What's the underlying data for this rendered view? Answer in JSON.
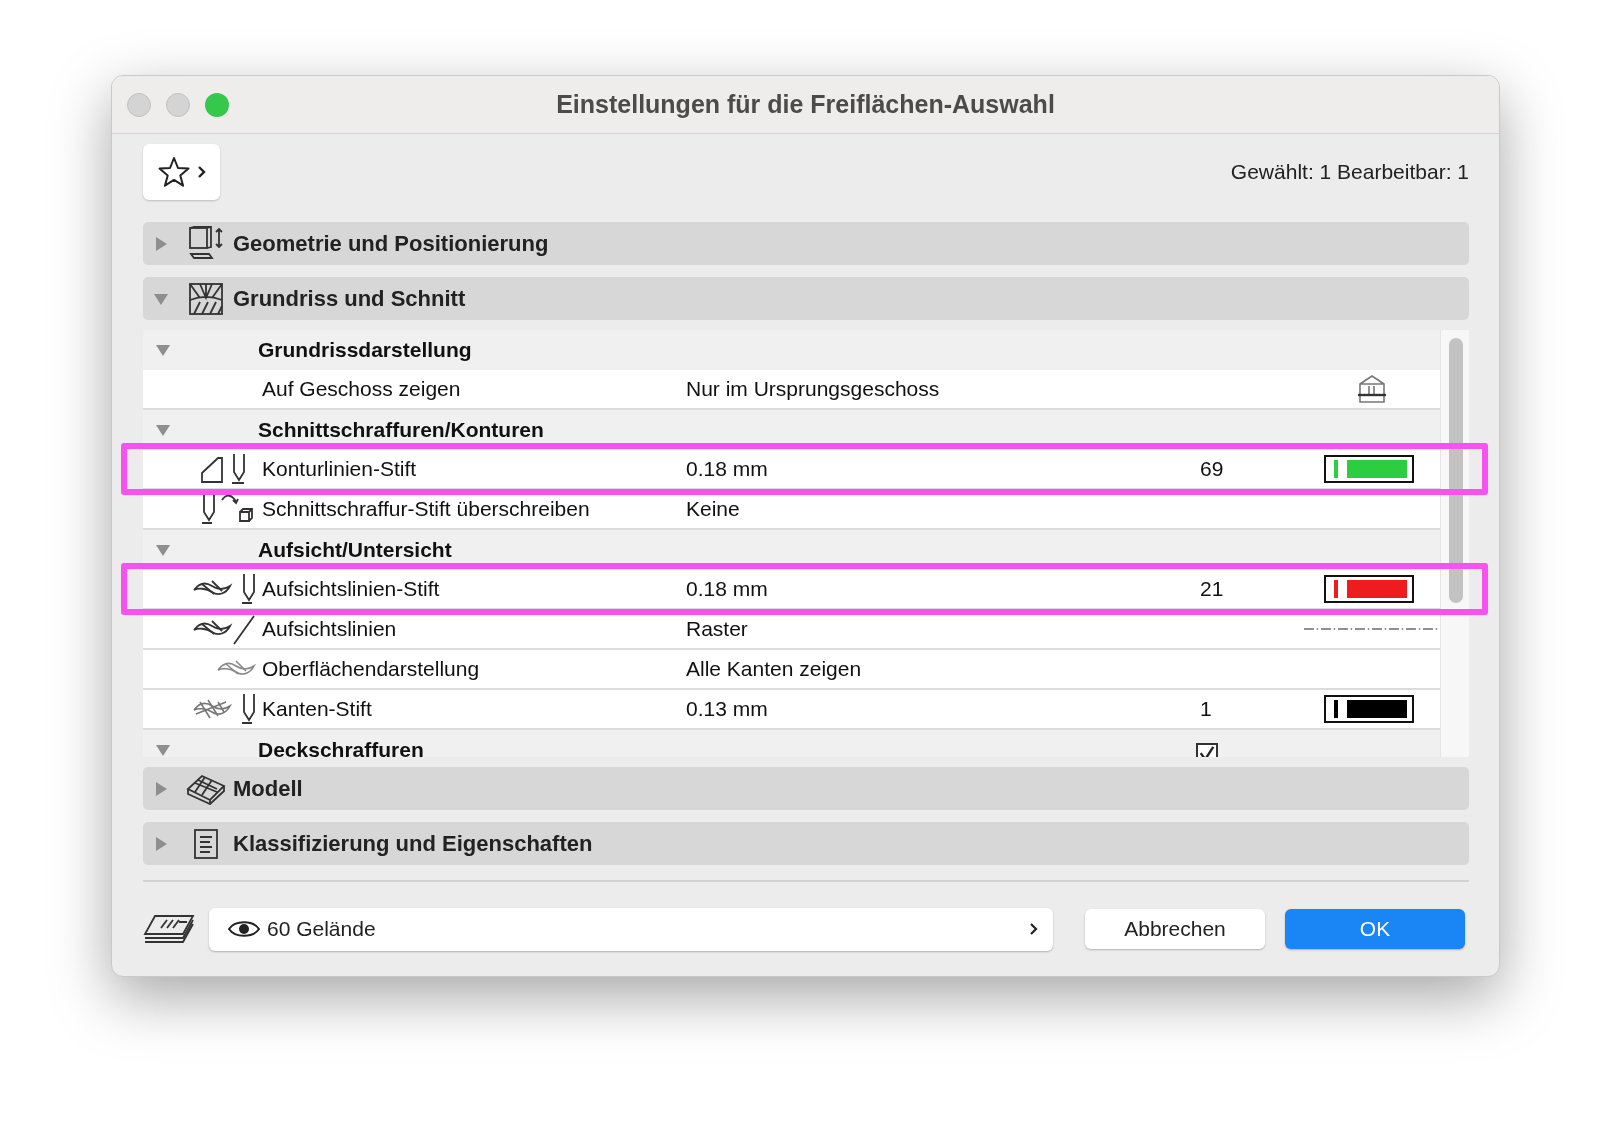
{
  "window": {
    "title": "Einstellungen für die Freiflächen-Auswahl"
  },
  "selection_info": "Gewählt: 1 Bearbeitbar: 1",
  "panels": [
    {
      "kind": "geometry",
      "title": "Geometrie und Positionierung",
      "expanded": false
    },
    {
      "kind": "plan",
      "title": "Grundriss und Schnitt",
      "expanded": true,
      "rows": [
        {
          "kind": "group",
          "label": "Grundrissdarstellung",
          "expanded": true
        },
        {
          "kind": "storey",
          "label": "Auf Geschoss zeigen",
          "value": "Nur im Ursprungsgeschoss",
          "highlighted": false
        },
        {
          "kind": "group",
          "label": "Schnittschraffuren/Konturen",
          "expanded": true
        },
        {
          "kind": "contour-pen",
          "label": "Konturlinien-Stift",
          "value": "0.18 mm",
          "pen": "69",
          "color": "#2ecc40",
          "highlighted": true
        },
        {
          "kind": "fill-pen",
          "label": "Schnittschraffur-Stift überschreiben",
          "value": "Keine",
          "highlighted": false
        },
        {
          "kind": "group",
          "label": "Aufsicht/Untersicht",
          "expanded": true
        },
        {
          "kind": "view-pen",
          "label": "Aufsichtslinien-Stift",
          "value": "0.18 mm",
          "pen": "21",
          "color": "#ee1c1c",
          "highlighted": true
        },
        {
          "kind": "view-lines",
          "label": "Aufsichtslinien",
          "value": "Raster",
          "highlighted": false
        },
        {
          "kind": "surface",
          "label": "Oberflächendarstellung",
          "value": "Alle Kanten zeigen",
          "highlighted": false
        },
        {
          "kind": "edge-pen",
          "label": "Kanten-Stift",
          "value": "0.13 mm",
          "pen": "1",
          "color": "#000000",
          "highlighted": false
        },
        {
          "kind": "group",
          "label": "Deckschraffuren",
          "expanded": true,
          "checked": true
        }
      ]
    },
    {
      "kind": "model",
      "title": "Modell",
      "expanded": false
    },
    {
      "kind": "info",
      "title": "Klassifizierung und Eigenschaften",
      "expanded": false
    }
  ],
  "layer": {
    "value": "60 Gelände"
  },
  "buttons": [
    {
      "kind": "cancel",
      "label": "Abbrechen"
    },
    {
      "kind": "ok",
      "label": "OK"
    }
  ]
}
